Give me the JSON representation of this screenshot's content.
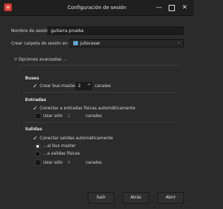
{
  "window": {
    "title": "Configuración de sesión",
    "min_glyph": "—",
    "close_glyph": "✕"
  },
  "session_name": {
    "label": "Nombre de sesión:",
    "value": "guitarra prueba"
  },
  "session_folder": {
    "label": "Crear carpeta de sesión en :",
    "value": "juliocesar",
    "chevron": "⌄"
  },
  "advanced": {
    "label": "Opciones avanzadas ...",
    "arrow": "▽"
  },
  "buses": {
    "title": "Buses",
    "create_master_label": "Crear bus master",
    "channels_value": "2",
    "channels_label": "canales"
  },
  "inputs": {
    "title": "Entradas",
    "auto_connect_label": "Conectar a entradas físicas automáticamente",
    "use_only_label": "Usar sólo",
    "use_only_value": "1",
    "channels_label": "canales"
  },
  "outputs": {
    "title": "Salidas",
    "auto_connect_label": "Conectar salidas automáticamente",
    "master_bus_label": "...al bus master",
    "physical_label": "...a salidas físicas",
    "use_only_label": "Usar sólo",
    "use_only_value": "0",
    "channels_label": "canales"
  },
  "buttons": {
    "quit": "Salir",
    "back": "Atrás",
    "open": "Abrir"
  },
  "check_glyph": "✓",
  "spin_glyph": "▴▾",
  "grip_glyph": "⋰"
}
